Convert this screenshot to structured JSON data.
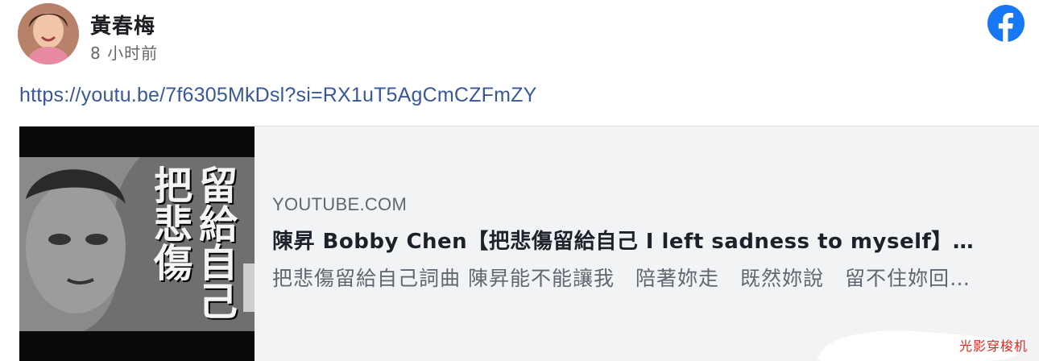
{
  "post": {
    "author": "黃春梅",
    "time": "8 小时前",
    "link_text": "https://youtu.be/7f6305MkDsl?si=RX1uT5AgCmCZFmZY"
  },
  "preview": {
    "domain": "YOUTUBE.COM",
    "title": "陳昇 Bobby Chen【把悲傷留給自己 I left sadness to myself】…",
    "description": "把悲傷留給自己詞曲 陳昇能不能讓我　陪著妳走　既然妳說　留不住妳回…",
    "thumbnail_text_col1": "把悲傷",
    "thumbnail_text_col2": "留給自己"
  },
  "watermark": "光影穿梭机",
  "icons": {
    "brand": "facebook-icon",
    "avatar": "profile-photo"
  },
  "colors": {
    "link": "#385898",
    "brand": "#1877f2",
    "card_bg": "#f2f3f5",
    "watermark": "#e0281f"
  }
}
